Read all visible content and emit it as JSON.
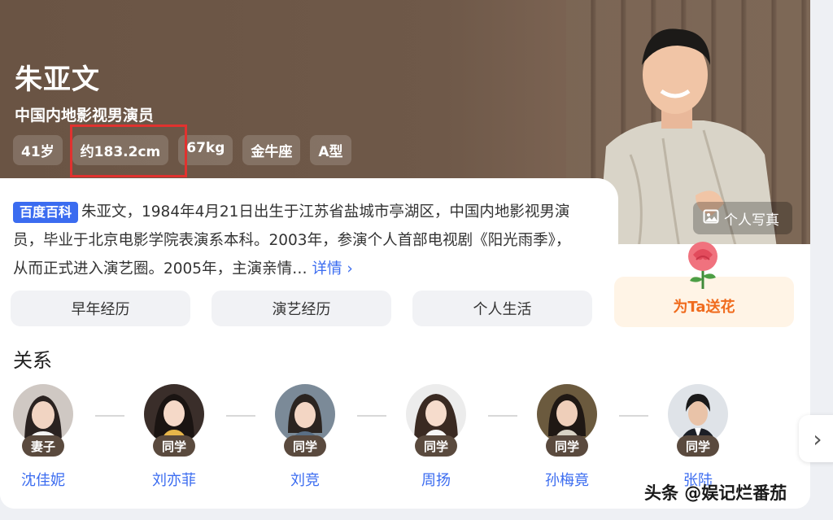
{
  "hero": {
    "name": "朱亚文",
    "subtitle": "中国内地影视男演员",
    "tags": [
      "41岁",
      "约183.2cm",
      "67kg",
      "金牛座",
      "A型"
    ],
    "photo_button": "个人写真"
  },
  "intro": {
    "badge": "百度百科",
    "text": "朱亚文，1984年4月21日出生于江苏省盐城市亭湖区，中国内地影视男演员，毕业于北京电影学院表演系本科。2003年，参演个人首部电视剧《阳光雨季》，从而正式进入演艺圈。2005年，主演亲情…",
    "more": "详情 ›"
  },
  "tabs": [
    "早年经历",
    "演艺经历",
    "个人生活"
  ],
  "flower_button": "为Ta送花",
  "relations": {
    "title": "关系",
    "items": [
      {
        "role": "妻子",
        "name": "沈佳妮"
      },
      {
        "role": "同学",
        "name": "刘亦菲"
      },
      {
        "role": "同学",
        "name": "刘竞"
      },
      {
        "role": "同学",
        "name": "周扬"
      },
      {
        "role": "同学",
        "name": "孙梅竟"
      },
      {
        "role": "同学",
        "name": "张陆"
      }
    ]
  },
  "next_icon": "chevron-right-icon",
  "watermark": "头条 @娱记烂番茄",
  "colors": {
    "accent": "#3b6cf0",
    "highlight": "#e0322f",
    "flower": "#f06b1d"
  }
}
